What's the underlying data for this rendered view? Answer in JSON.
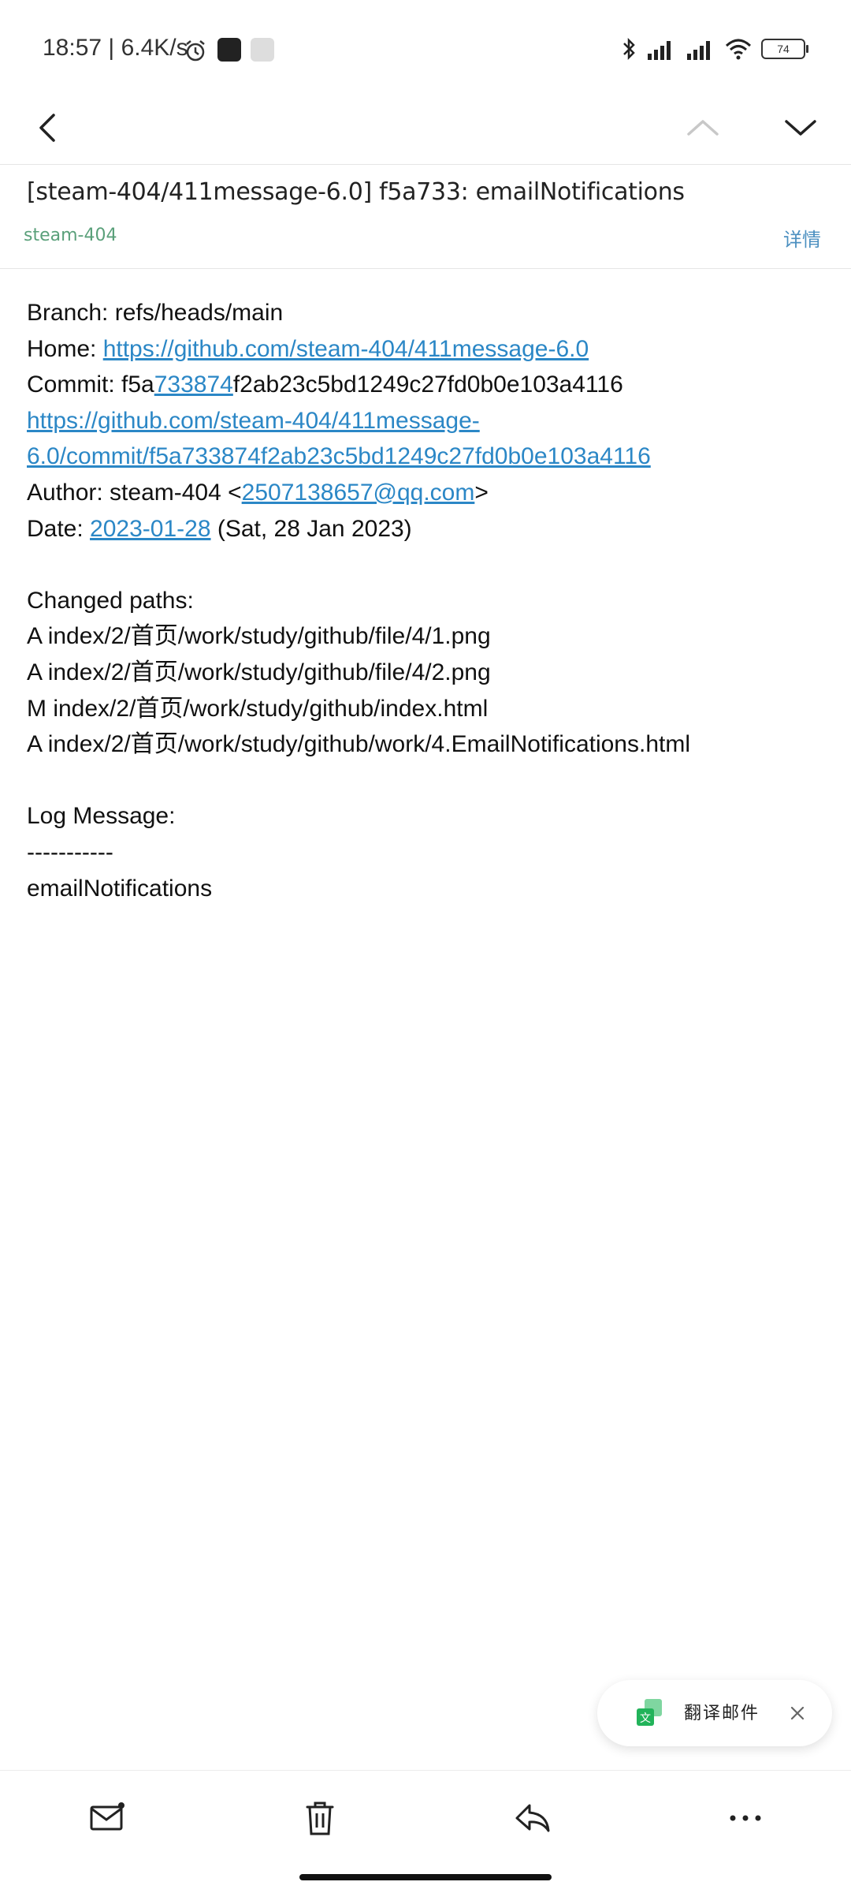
{
  "status_bar": {
    "time": "18:57",
    "net_speed": "6.4K/s",
    "battery": "74"
  },
  "email": {
    "subject": "[steam-404/411message-6.0] f5a733: emailNotifications",
    "sender": "steam-404",
    "details_label": "详情",
    "body": {
      "branch_label": "Branch: ",
      "branch_value": "refs/heads/main",
      "home_label": "Home: ",
      "home_url": "https://github.com/steam-404/411message-6.0",
      "commit_label": "Commit: ",
      "commit_prefix": "f5a",
      "commit_link": "733874",
      "commit_suffix": "f2ab23c5bd1249c27fd0b0e103a4116",
      "commit_url_line1": "https://github.com/steam-404/411message-",
      "commit_url_line2": "6.0/commit/f5a733874f2ab23c5bd1249c27fd0b0e103a4116",
      "author_label": "Author: steam-404 <",
      "author_email": "2507138657@qq.com",
      "author_close": ">",
      "date_label": "Date: ",
      "date_link": "2023-01-28",
      "date_suffix": " (Sat, 28 Jan 2023)",
      "changed_paths_label": "Changed paths:",
      "paths": [
        "A index/2/首页/work/study/github/file/4/1.png",
        "A index/2/首页/work/study/github/file/4/2.png",
        "M index/2/首页/work/study/github/index.html",
        "A index/2/首页/work/study/github/work/4.EmailNotifications.html"
      ],
      "log_label": "Log Message:",
      "log_separator": "-----------",
      "log_message": "emailNotifications"
    }
  },
  "translate_chip": {
    "label": "翻译邮件"
  },
  "colors": {
    "link": "#2b87c6",
    "sender": "#5aa07a",
    "details": "#4b8fc0"
  },
  "icons": {
    "nav": [
      "back-icon",
      "up-arrow-icon",
      "down-arrow-icon"
    ],
    "bottom_bar": [
      "mark-unread-icon",
      "trash-icon",
      "reply-icon",
      "more-icon"
    ]
  }
}
